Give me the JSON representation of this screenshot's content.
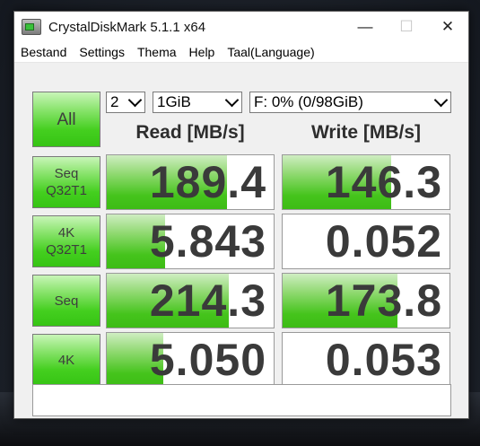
{
  "window": {
    "title": "CrystalDiskMark 5.1.1 x64",
    "controls": {
      "minimize": "—",
      "maximize": "☐",
      "close": "✕"
    }
  },
  "menu": [
    "Bestand",
    "Settings",
    "Thema",
    "Help",
    "Taal(Language)"
  ],
  "toolbar": {
    "all_label": "All",
    "count": "2",
    "size": "1GiB",
    "drive": "F: 0% (0/98GiB)"
  },
  "headers": {
    "read": "Read [MB/s]",
    "write": "Write [MB/s]"
  },
  "tests": [
    {
      "label_line1": "Seq",
      "label_line2": "Q32T1",
      "read": "189.4",
      "write": "146.3",
      "read_fill": 0.72,
      "write_fill": 0.65
    },
    {
      "label_line1": "4K",
      "label_line2": "Q32T1",
      "read": "5.843",
      "write": "0.052",
      "read_fill": 0.35,
      "write_fill": 0.0
    },
    {
      "label_line1": "Seq",
      "label_line2": "",
      "read": "214.3",
      "write": "173.8",
      "read_fill": 0.73,
      "write_fill": 0.69
    },
    {
      "label_line1": "4K",
      "label_line2": "",
      "read": "5.050",
      "write": "0.053",
      "read_fill": 0.34,
      "write_fill": 0.0
    }
  ],
  "status": ""
}
